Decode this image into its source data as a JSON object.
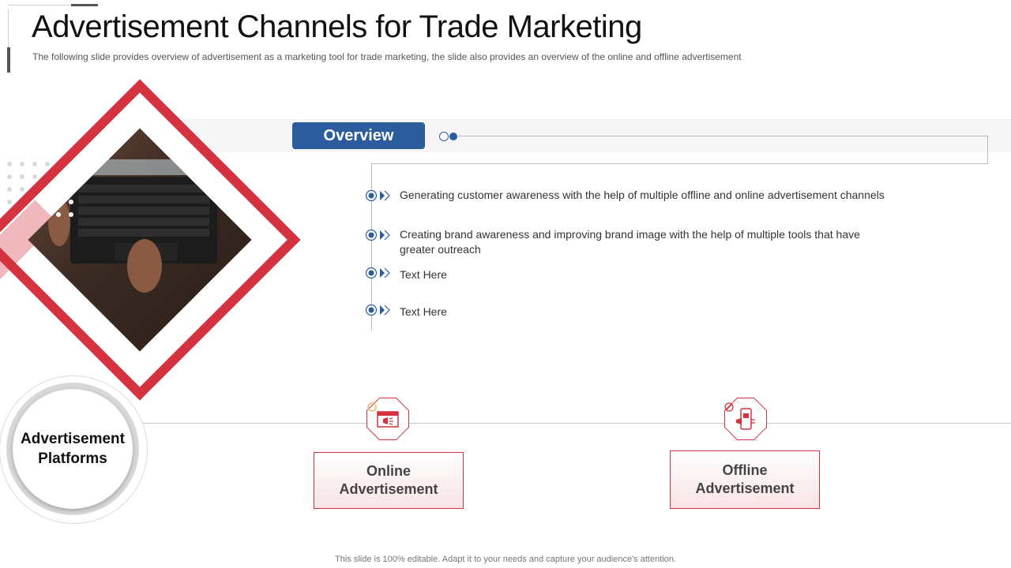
{
  "header": {
    "title": "Advertisement Channels for Trade Marketing",
    "subtitle": "The following slide provides overview of advertisement as a marketing tool for trade marketing, the slide also provides an overview of the online and offline advertisement"
  },
  "overview": {
    "label": "Overview",
    "bullets": [
      "Generating customer awareness with the help of multiple offline and online advertisement channels",
      "Creating brand awareness and improving brand image with the help of multiple tools that have",
      "greater outreach",
      "Text Here",
      "Text Here"
    ]
  },
  "platforms": {
    "hub_label_line1": "Advertisement",
    "hub_label_line2": "Platforms",
    "online": {
      "line1": "Online",
      "line2": "Advertisement",
      "icon": "online-ad-icon"
    },
    "offline": {
      "line1": "Offline",
      "line2": "Advertisement",
      "icon": "offline-ad-icon"
    }
  },
  "footer": {
    "note": "This slide is 100% editable. Adapt it to your needs and capture your audience's attention."
  },
  "colors": {
    "accent_red": "#d4323f",
    "accent_blue": "#2b5c9e"
  }
}
